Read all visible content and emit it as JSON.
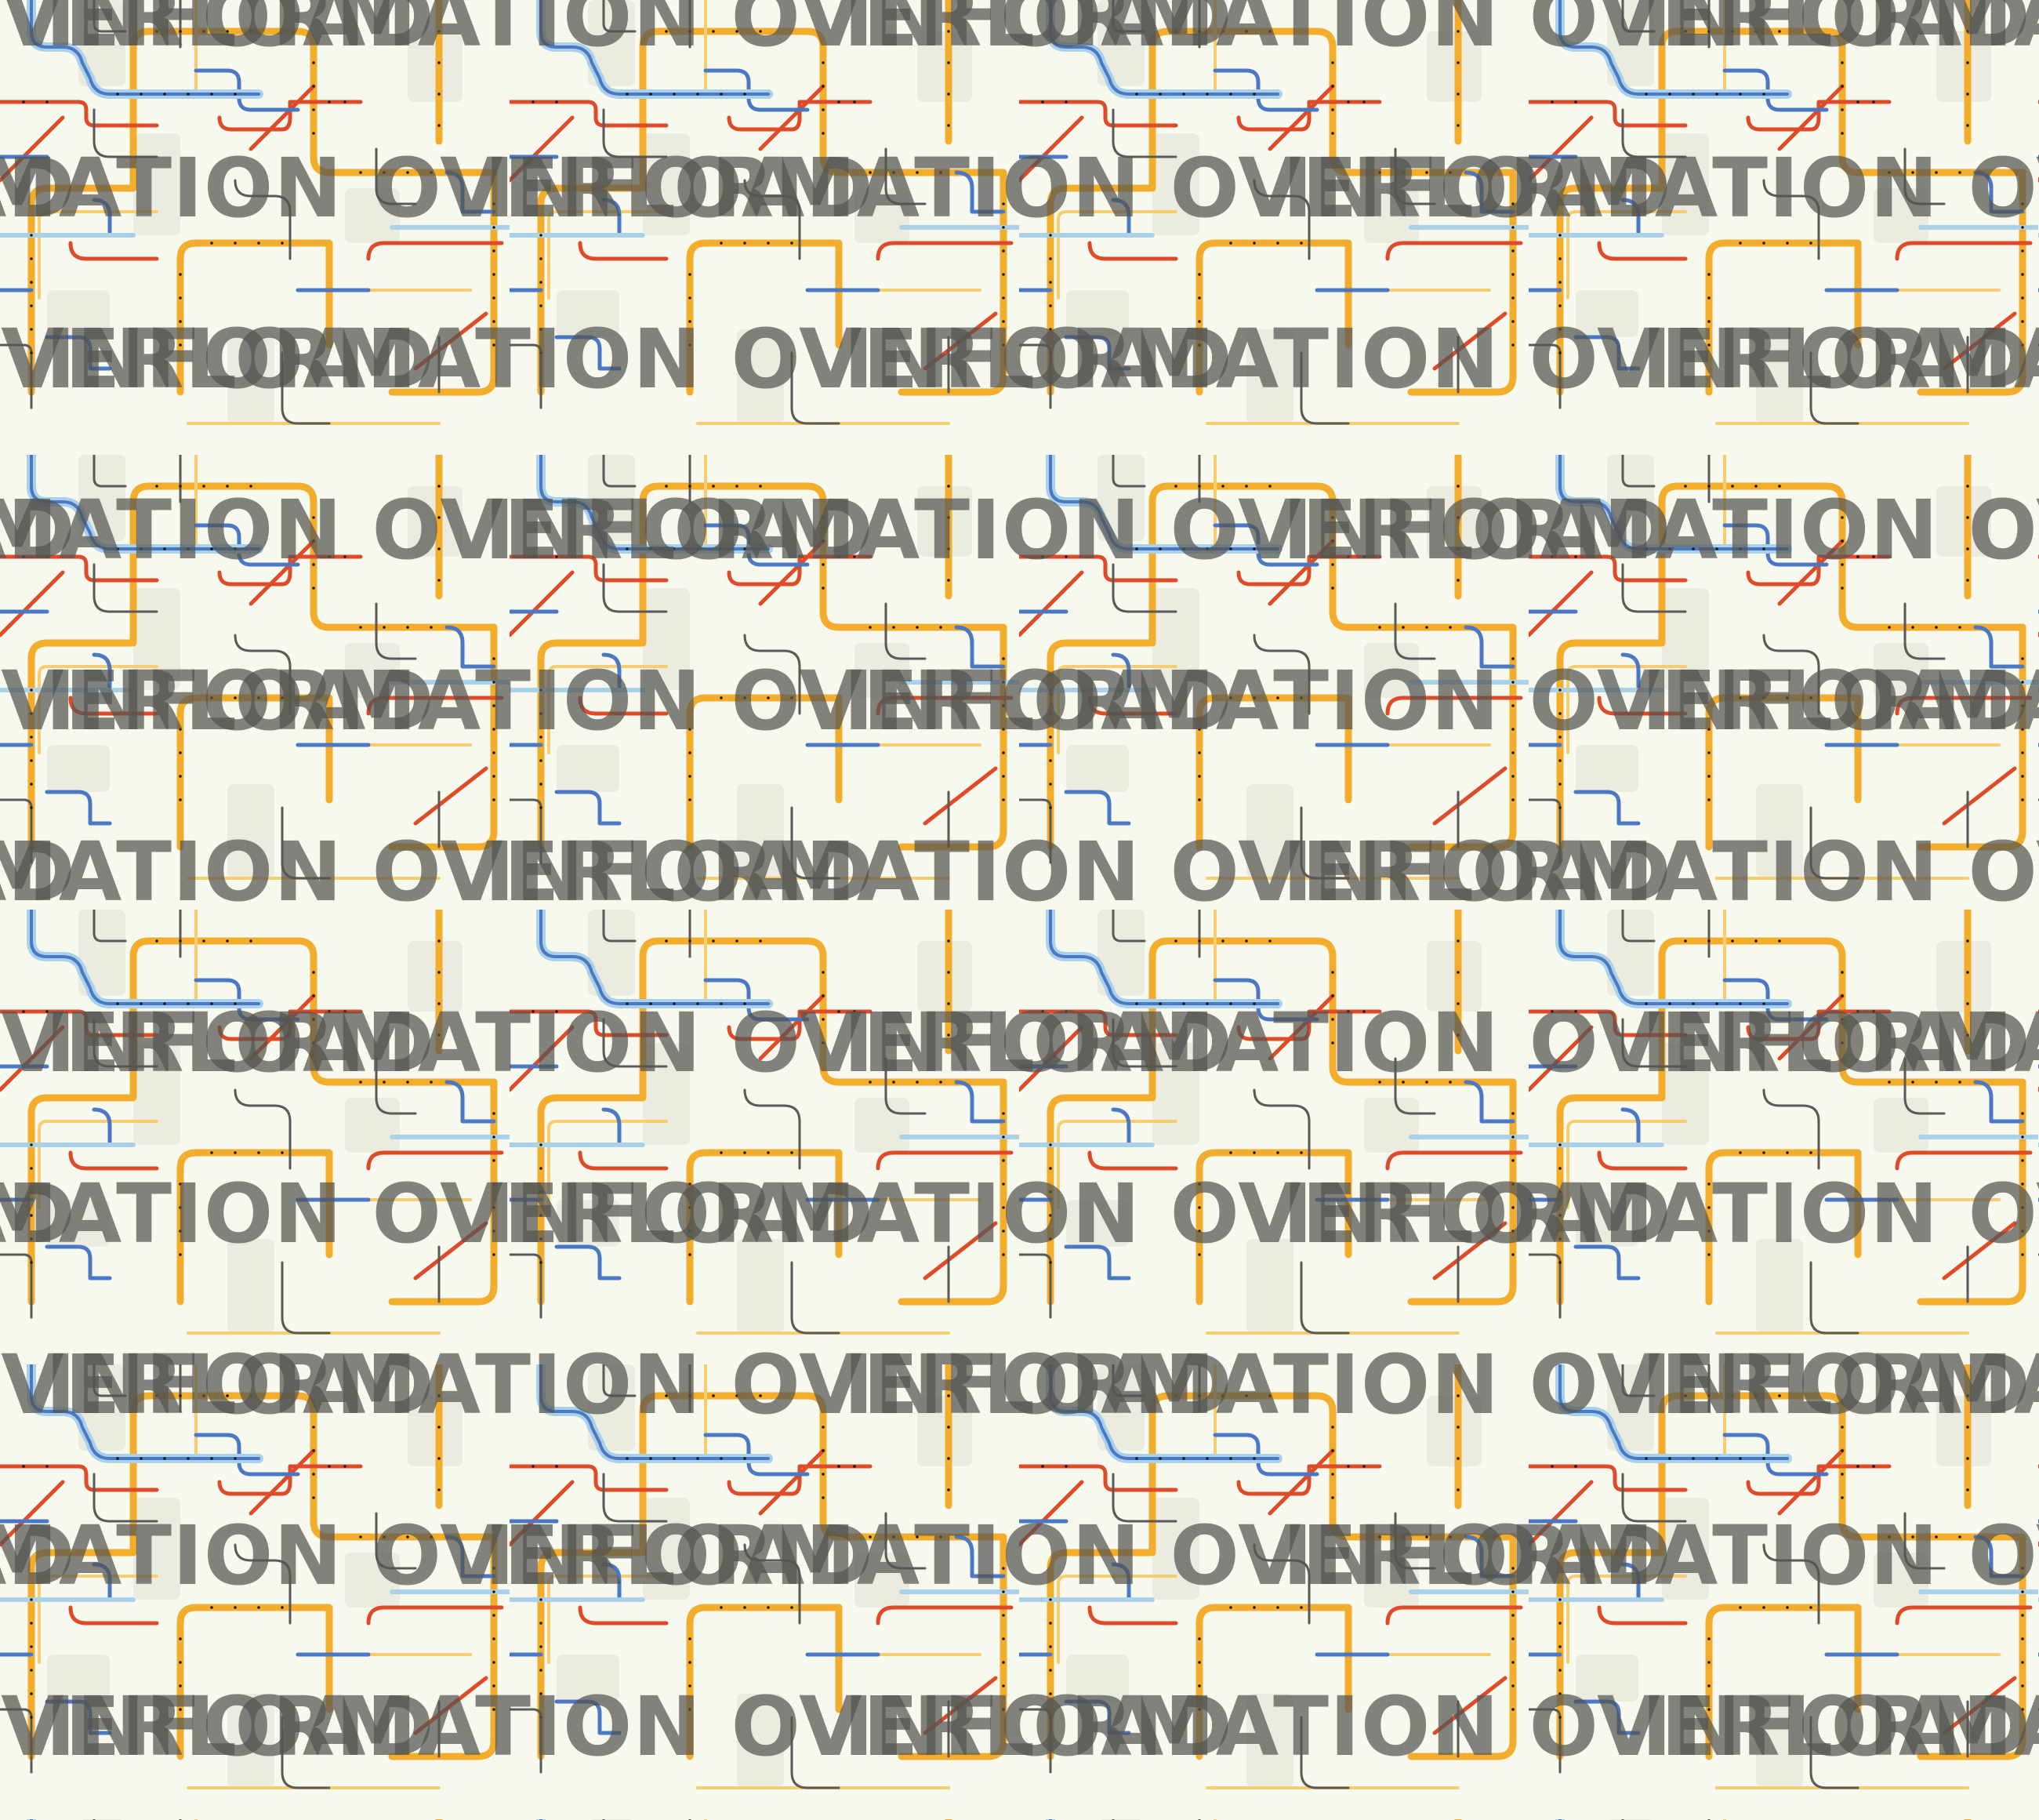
{
  "watermark": {
    "text": "INFORMATION OVERLOAD"
  },
  "colors": {
    "background": "#f7f8ee",
    "orange_line": "#f3ad2c",
    "orange_line_light": "#f8cd6f",
    "red_line": "#df4b28",
    "blue_line": "#4a78c4",
    "light_blue_line": "#a9d2ea",
    "gray_line": "#5a5a5a",
    "block_shade": "#e8e8de",
    "station_dot": "#1a1a1a",
    "watermark": "#555550"
  },
  "pattern": {
    "description_icon": "transit-map-icon",
    "line_names": [
      "orange-line",
      "red-line",
      "blue-line",
      "light-blue-line",
      "gray-line"
    ]
  }
}
